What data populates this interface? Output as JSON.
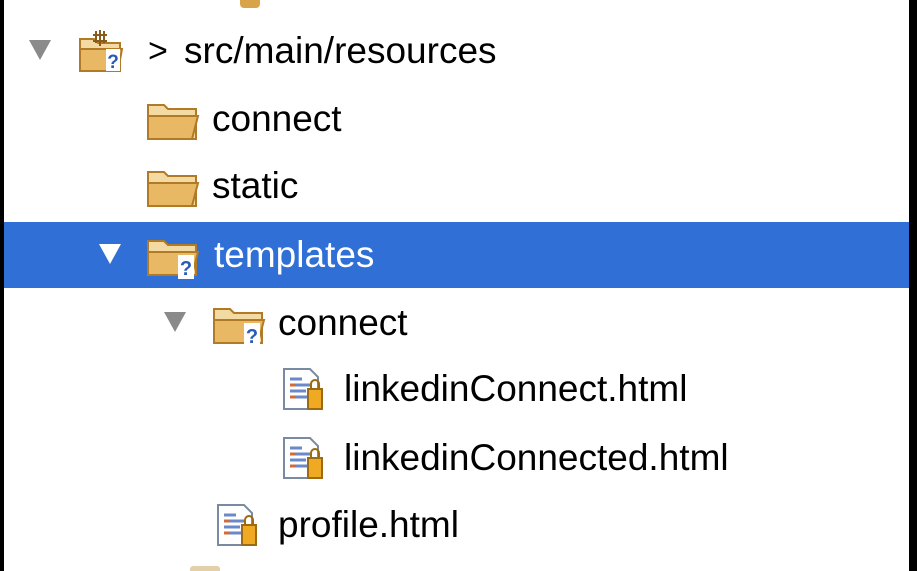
{
  "tree": {
    "root": {
      "prefix": ">",
      "label": "src/main/resources",
      "expanded": true,
      "icon": "package-folder-icon"
    },
    "items": [
      {
        "label": "connect",
        "icon": "folder-icon",
        "expanded": false
      },
      {
        "label": "static",
        "icon": "folder-icon",
        "expanded": false
      },
      {
        "label": "templates",
        "icon": "folder-question-icon",
        "expanded": true,
        "selected": true
      },
      {
        "label": "connect",
        "icon": "folder-question-icon",
        "expanded": true
      },
      {
        "label": "linkedinConnect.html",
        "icon": "html-file-icon"
      },
      {
        "label": "linkedinConnected.html",
        "icon": "html-file-icon"
      },
      {
        "label": "profile.html",
        "icon": "html-file-icon"
      }
    ]
  },
  "colors": {
    "selection": "#2f6fd6",
    "folder": "#e0a94e",
    "twisty": "#8a8a8a"
  }
}
